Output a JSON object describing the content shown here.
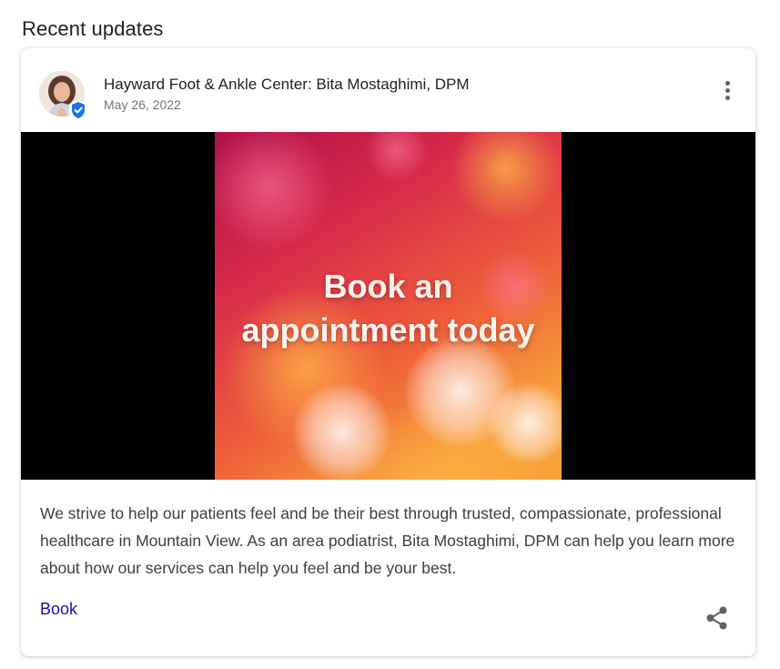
{
  "section": {
    "title": "Recent updates"
  },
  "post": {
    "author": "Hayward Foot & Ankle Center: Bita Mostaghimi, DPM",
    "date": "May 26, 2022",
    "verified_icon": "verified-check-icon",
    "menu_icon": "more-vert-icon",
    "image_text_line1": "Book an",
    "image_text_line2": "appointment today",
    "body": "We strive to help our patients feel and be their best through trusted, compassionate, professional healthcare in Mountain View. As an area podiatrist, Bita Mostaghimi, DPM can help you learn more about how our services can help you feel and be your best.",
    "cta_label": "Book",
    "share_icon": "share-icon"
  },
  "colors": {
    "link": "#1a0dab",
    "verified": "#1a73e8",
    "icon": "#5f6368"
  }
}
